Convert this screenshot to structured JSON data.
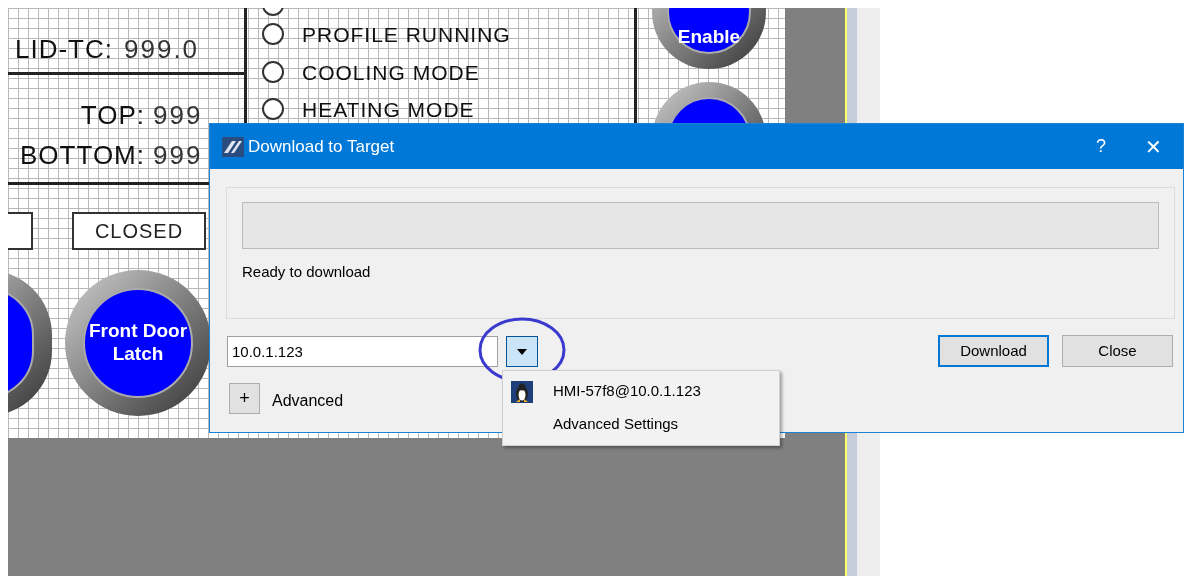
{
  "canvas": {
    "readouts": [
      {
        "label": "LID-TC:",
        "value": "999.0"
      },
      {
        "label": "TOP:",
        "value": "999"
      },
      {
        "label": "BOTTOM:",
        "value": "999"
      }
    ],
    "indicators": [
      {
        "label": "PROFILE RUNNING",
        "on": false
      },
      {
        "label": "COOLING MODE",
        "on": false
      },
      {
        "label": "HEATING MODE",
        "on": false
      }
    ],
    "status_box": "CLOSED",
    "round_buttons": [
      {
        "label": "Enable"
      },
      {
        "label": "Front Door Latch"
      }
    ]
  },
  "dialog": {
    "title": "Download to Target",
    "help": "?",
    "close": "✕",
    "progress": {
      "level": 0
    },
    "status": "Ready to download",
    "address": {
      "value": "10.0.1.123",
      "menu_open": true
    },
    "buttons": [
      {
        "label": "Download",
        "focused": true
      },
      {
        "label": "Close",
        "focused": false
      }
    ],
    "advanced": {
      "toggle": "+",
      "label": "Advanced"
    },
    "menu": [
      {
        "label": "HMI-57f8@10.0.1.123",
        "icon": true
      },
      {
        "label": "Advanced Settings",
        "icon": false
      }
    ]
  }
}
